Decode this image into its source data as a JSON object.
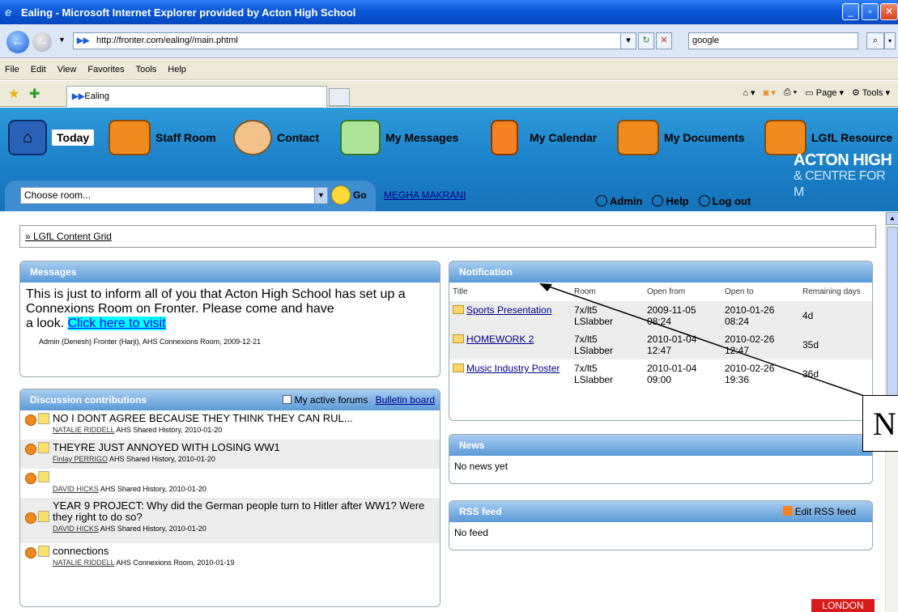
{
  "window": {
    "title": "Ealing - Microsoft Internet Explorer provided by Acton High School"
  },
  "address": {
    "url": "http://fronter.com/ealing//main.phtml",
    "search": "google"
  },
  "menu": [
    "File",
    "Edit",
    "View",
    "Favorites",
    "Tools",
    "Help"
  ],
  "tab": {
    "label": "Ealing"
  },
  "toolbar": {
    "page": "Page",
    "tools": "Tools"
  },
  "nav": {
    "today": "Today",
    "staff_room": "Staff Room",
    "contact": "Contact",
    "my_messages": "My Messages",
    "my_calendar": "My Calendar",
    "my_documents": "My Documents",
    "lgfl": "LGfL Resource"
  },
  "school": {
    "line1": "ACTON HIGH",
    "line2": "& CENTRE FOR M"
  },
  "room": {
    "placeholder": "Choose room...",
    "go": "Go"
  },
  "user": {
    "name": "MEGHA MAKRANI"
  },
  "links": {
    "admin": "Admin",
    "help": "Help",
    "logout": "Log out"
  },
  "content_grid": "» LGfL Content Grid",
  "messages": {
    "title": "Messages",
    "body_line1": "This is just to inform all of you that Acton High School has set up a",
    "body_line2": "Connexions Room on Fronter. Please come and have",
    "body_line3": "a look.",
    "link": "Click here to visit",
    "meta": "Admin (Denesh) Fronter (Harji),  AHS Connexions Room,  2009-12-21"
  },
  "discussion": {
    "title": "Discussion contributions",
    "my_forums": "My active forums",
    "bulletin": "Bulletin board",
    "items": [
      {
        "text": "NO I DONT AGREE BECAUSE THEY THINK THEY CAN RUL...",
        "author": "NATALIE RIDDELL",
        "meta": " AHS Shared History, 2010-01-20"
      },
      {
        "text": "THEYRE JUST ANNOYED WITH LOSING WW1",
        "author": "Finlay PERRIGO",
        "meta": " AHS Shared History, 2010-01-20"
      },
      {
        "text": "",
        "author": "DAVID HICKS",
        "meta": " AHS Shared History, 2010-01-20"
      },
      {
        "text": "YEAR 9 PROJECT: Why did the German people turn to Hitler after WW1? Were they right to do so?",
        "author": "DAVID HICKS",
        "meta": " AHS Shared History, 2010-01-20"
      },
      {
        "text": "connections",
        "author": "NATALIE RIDDELL",
        "meta": " AHS Connexions Room, 2010-01-19"
      }
    ]
  },
  "notification": {
    "title": "Notification",
    "headers": [
      "Title",
      "Room",
      "Open from",
      "Open to",
      "Remaining days"
    ],
    "rows": [
      {
        "title": "Sports Presentation",
        "room1": "7x/lt5",
        "room2": "LSlabber",
        "from1": "2009-11-05",
        "from2": "08:24",
        "to1": "2010-01-26",
        "to2": "08:24",
        "days": "4d"
      },
      {
        "title": "HOMEWORK 2",
        "room1": "7x/lt5",
        "room2": "LSlabber",
        "from1": "2010-01-04",
        "from2": "12:47",
        "to1": "2010-02-26",
        "to2": "12:47",
        "days": "35d"
      },
      {
        "title": "Music Industry Poster",
        "room1": "7x/lt5",
        "room2": "LSlabber",
        "from1": "2010-01-04",
        "from2": "09:00",
        "to1": "2010-02-26",
        "to2": "19:36",
        "days": "36d"
      }
    ]
  },
  "news": {
    "title": "News",
    "body": "No news yet"
  },
  "rss": {
    "title": "RSS feed",
    "edit": "Edit RSS feed",
    "body": "No feed"
  },
  "london": "LONDON",
  "callout": "N"
}
